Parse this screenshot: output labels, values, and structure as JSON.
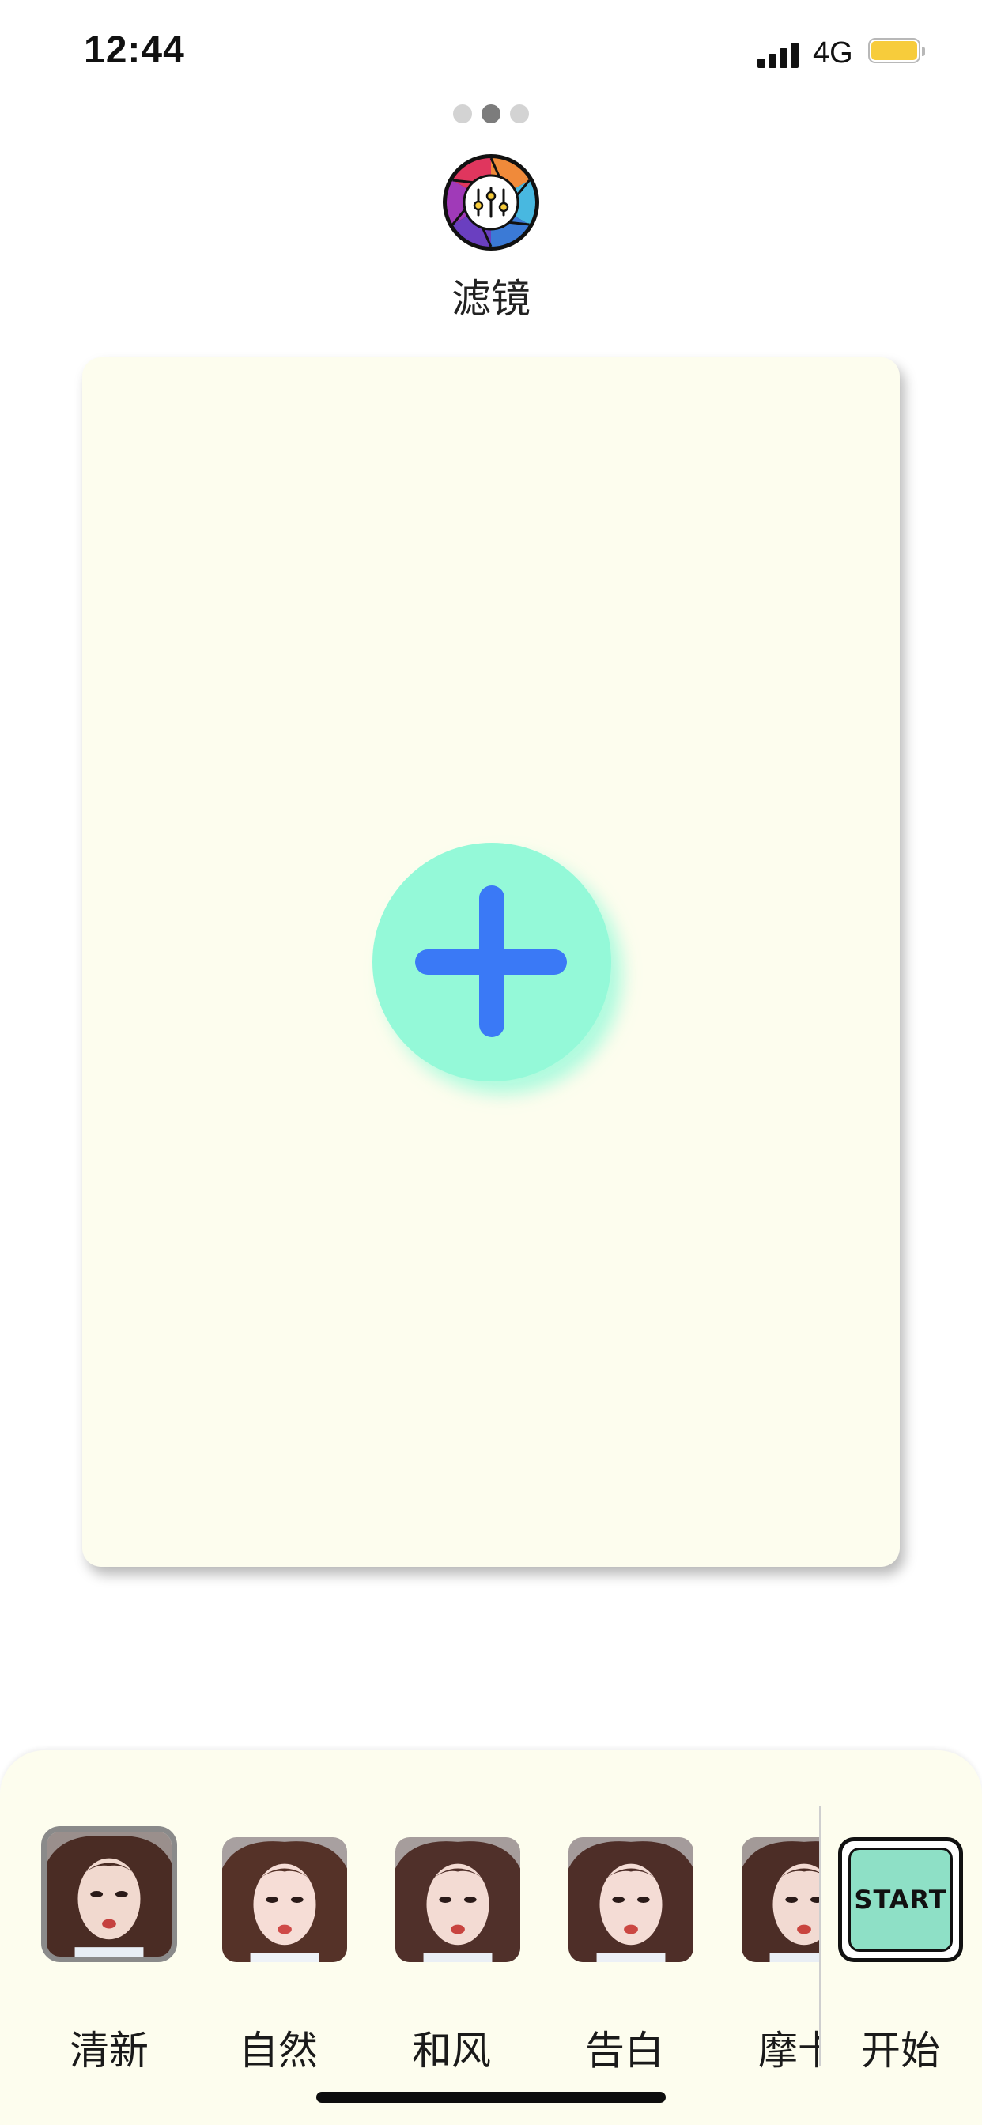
{
  "status_bar": {
    "time": "12:44",
    "network": "4G",
    "battery_color": "#f7cc3b"
  },
  "pager": {
    "count": 3,
    "active_index": 1
  },
  "app": {
    "icon": "aperture-sliders-icon",
    "title": "滤镜"
  },
  "canvas": {
    "add_icon": "plus-icon",
    "background": "#fdfdee",
    "add_button_color": "#94f9d8",
    "plus_color": "#3a79f6"
  },
  "filters": {
    "items": [
      {
        "label": "清新",
        "thumbnail": "portrait-thumbnail",
        "selected": true
      },
      {
        "label": "自然",
        "thumbnail": "portrait-thumbnail",
        "selected": false
      },
      {
        "label": "和风",
        "thumbnail": "portrait-thumbnail",
        "selected": false
      },
      {
        "label": "告白",
        "thumbnail": "portrait-thumbnail",
        "selected": false
      },
      {
        "label": "摩卡",
        "thumbnail": "portrait-thumbnail",
        "selected": false
      }
    ]
  },
  "start": {
    "badge_text": "START",
    "label": "开始",
    "color": "#8ee0c6"
  }
}
